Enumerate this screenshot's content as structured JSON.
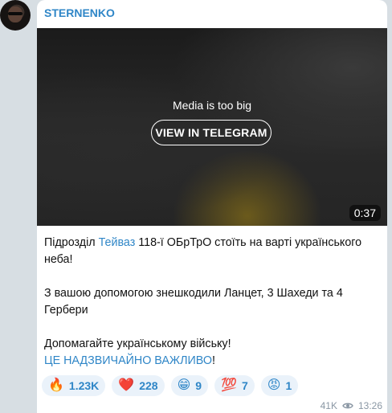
{
  "channel": {
    "name": "STERNENKO"
  },
  "media": {
    "message": "Media is too big",
    "button_label": "VIEW IN TELEGRAM",
    "duration": "0:37"
  },
  "post": {
    "line1_pre": "Підрозділ ",
    "line1_link": "Тейваз",
    "line1_post": " 118-ї ОБрТрО стоїть на варті українського неба!",
    "para2": "З вашою допомогою знешкодили Ланцет, 3 Шахеди та 4 Гербери",
    "para3_line1": "Допомагайте українському війську!",
    "para3_link": "ЦЕ НАДЗВИЧАЙНО ВАЖЛИВО",
    "para3_end": "!"
  },
  "reactions": [
    {
      "emoji": "🔥",
      "icon": "fire-icon",
      "count": "1.23K"
    },
    {
      "emoji": "❤️",
      "icon": "heart-icon",
      "count": "228"
    },
    {
      "emoji": "😁",
      "icon": "grin-icon",
      "count": "9"
    },
    {
      "emoji": "💯",
      "icon": "hundred-icon",
      "count": "7"
    },
    {
      "emoji": "😡",
      "icon": "angry-icon",
      "count": "1"
    }
  ],
  "meta": {
    "views": "41K",
    "time": "13:26"
  },
  "colors": {
    "accent": "#2f86c7",
    "background": "#d7dee3",
    "bubble": "#ffffff"
  }
}
